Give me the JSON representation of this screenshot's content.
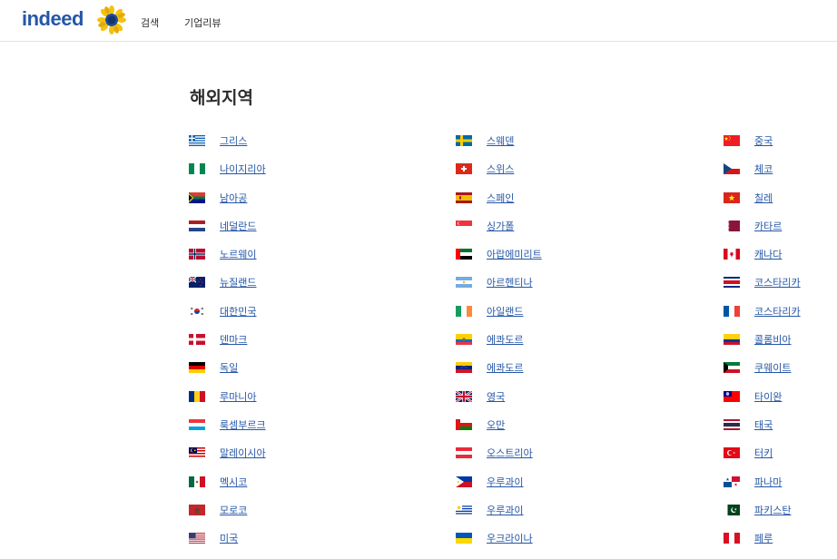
{
  "header": {
    "logo": "indeed",
    "nav": {
      "search": "검색",
      "company_reviews": "기업리뷰"
    }
  },
  "section_title": "해외지역",
  "columns": [
    [
      {
        "name": "그리스",
        "flag": "greece"
      },
      {
        "name": "나이지리아",
        "flag": "nigeria"
      },
      {
        "name": "남아공",
        "flag": "south-africa"
      },
      {
        "name": "네덜란드",
        "flag": "netherlands"
      },
      {
        "name": "노르웨이",
        "flag": "norway"
      },
      {
        "name": "뉴질랜드",
        "flag": "new-zealand"
      },
      {
        "name": "대한민국",
        "flag": "south-korea"
      },
      {
        "name": "덴마크",
        "flag": "denmark"
      },
      {
        "name": "독일",
        "flag": "germany"
      },
      {
        "name": "루마니아",
        "flag": "romania"
      },
      {
        "name": "룩셈부르크",
        "flag": "luxembourg"
      },
      {
        "name": "말레이시아",
        "flag": "malaysia"
      },
      {
        "name": "멕시코",
        "flag": "mexico"
      },
      {
        "name": "모로코",
        "flag": "morocco"
      },
      {
        "name": "미국",
        "flag": "usa"
      }
    ],
    [
      {
        "name": "스웨덴",
        "flag": "sweden"
      },
      {
        "name": "스위스",
        "flag": "switzerland"
      },
      {
        "name": "스페인",
        "flag": "spain"
      },
      {
        "name": "싱가폴",
        "flag": "singapore"
      },
      {
        "name": "아랍에미리트",
        "flag": "uae"
      },
      {
        "name": "아르헨티나",
        "flag": "argentina"
      },
      {
        "name": "아일랜드",
        "flag": "ireland"
      },
      {
        "name": "에콰도르",
        "flag": "ecuador"
      },
      {
        "name": "에콰도르",
        "flag": "venezuela"
      },
      {
        "name": "영국",
        "flag": "uk"
      },
      {
        "name": "오만",
        "flag": "oman"
      },
      {
        "name": "오스트리아",
        "flag": "austria"
      },
      {
        "name": "우루과이",
        "flag": "philippines"
      },
      {
        "name": "우루과이",
        "flag": "uruguay"
      },
      {
        "name": "우크라이나",
        "flag": "ukraine"
      }
    ],
    [
      {
        "name": "중국",
        "flag": "china"
      },
      {
        "name": "체코",
        "flag": "czech"
      },
      {
        "name": "칠레",
        "flag": "vietnam"
      },
      {
        "name": "카타르",
        "flag": "qatar"
      },
      {
        "name": "캐나다",
        "flag": "canada"
      },
      {
        "name": "코스타리카",
        "flag": "costa-rica"
      },
      {
        "name": "코스타리카",
        "flag": "france"
      },
      {
        "name": "콜롬비아",
        "flag": "colombia"
      },
      {
        "name": "쿠웨이트",
        "flag": "kuwait"
      },
      {
        "name": "타이완",
        "flag": "taiwan"
      },
      {
        "name": "태국",
        "flag": "thailand"
      },
      {
        "name": "터키",
        "flag": "turkey"
      },
      {
        "name": "파나마",
        "flag": "panama"
      },
      {
        "name": "파키스탄",
        "flag": "pakistan"
      },
      {
        "name": "페루",
        "flag": "peru"
      }
    ]
  ],
  "colors": {
    "link": "#2557a7",
    "brand": "#2557a7",
    "text": "#2d2d2d"
  }
}
